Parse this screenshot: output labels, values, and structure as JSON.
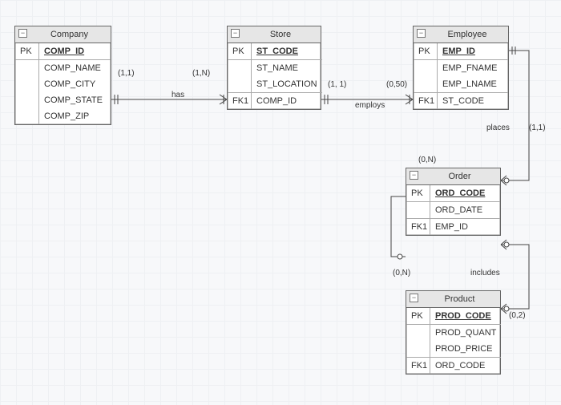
{
  "entities": {
    "company": {
      "title": "Company",
      "pk_label": "PK",
      "pk_field": "COMP_ID",
      "attrs": [
        "COMP_NAME",
        "COMP_CITY",
        "COMP_STATE",
        "COMP_ZIP"
      ]
    },
    "store": {
      "title": "Store",
      "pk_label": "PK",
      "pk_field": "ST_CODE",
      "attrs": [
        "ST_NAME",
        "ST_LOCATION"
      ],
      "fk_label": "FK1",
      "fk_field": "COMP_ID"
    },
    "employee": {
      "title": "Employee",
      "pk_label": "PK",
      "pk_field": "EMP_ID",
      "attrs": [
        "EMP_FNAME",
        "EMP_LNAME"
      ],
      "fk_label": "FK1",
      "fk_field": "ST_CODE"
    },
    "order": {
      "title": "Order",
      "pk_label": "PK",
      "pk_field": "ORD_CODE",
      "attrs": [
        "ORD_DATE"
      ],
      "fk_label": "FK1",
      "fk_field": "EMP_ID"
    },
    "product": {
      "title": "Product",
      "pk_label": "PK",
      "pk_field": "PROD_CODE",
      "attrs": [
        "PROD_QUANT",
        "PROD_PRICE"
      ],
      "fk_label": "FK1",
      "fk_field": "ORD_CODE"
    }
  },
  "relationships": {
    "has": {
      "label": "has",
      "card_left": "(1,1)",
      "card_right": "(1,N)"
    },
    "employs": {
      "label": "employs",
      "card_left": "(1, 1)",
      "card_right": "(0,50)"
    },
    "places": {
      "label": "places",
      "card_top": "(1,1)",
      "card_bottom": "(0,N)"
    },
    "includes": {
      "label": "includes",
      "card_top": "(0,N)",
      "card_bottom": "(0,2)"
    }
  },
  "icons": {
    "collapse": "−"
  }
}
